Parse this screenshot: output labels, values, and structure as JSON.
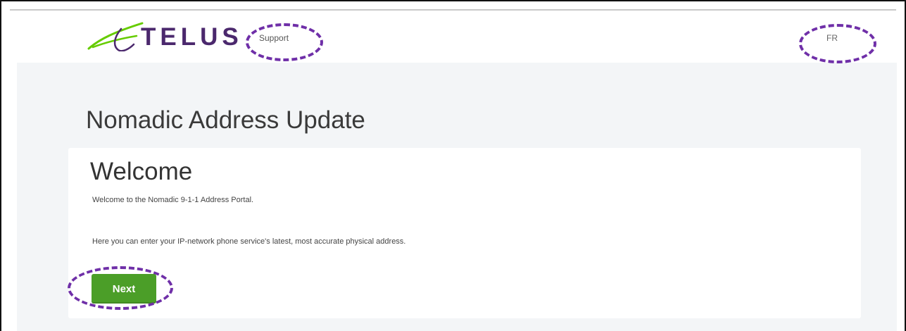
{
  "header": {
    "brand": "TELUS",
    "support_label": "Support",
    "language_label": "FR"
  },
  "page": {
    "title": "Nomadic Address Update"
  },
  "card": {
    "title": "Welcome",
    "intro": "Welcome to the Nomadic 9-1-1 Address Portal.",
    "detail": "Here you can enter your IP-network phone service's latest, most accurate physical address.",
    "next_label": "Next"
  },
  "colors": {
    "brand_purple": "#4b286d",
    "brand_green": "#66cc00",
    "button_green": "#4b9e28",
    "annotation_purple": "#6f2fa8",
    "page_background": "#f3f5f7"
  },
  "icons": {
    "logo": "telus-leaf-logo-icon"
  }
}
